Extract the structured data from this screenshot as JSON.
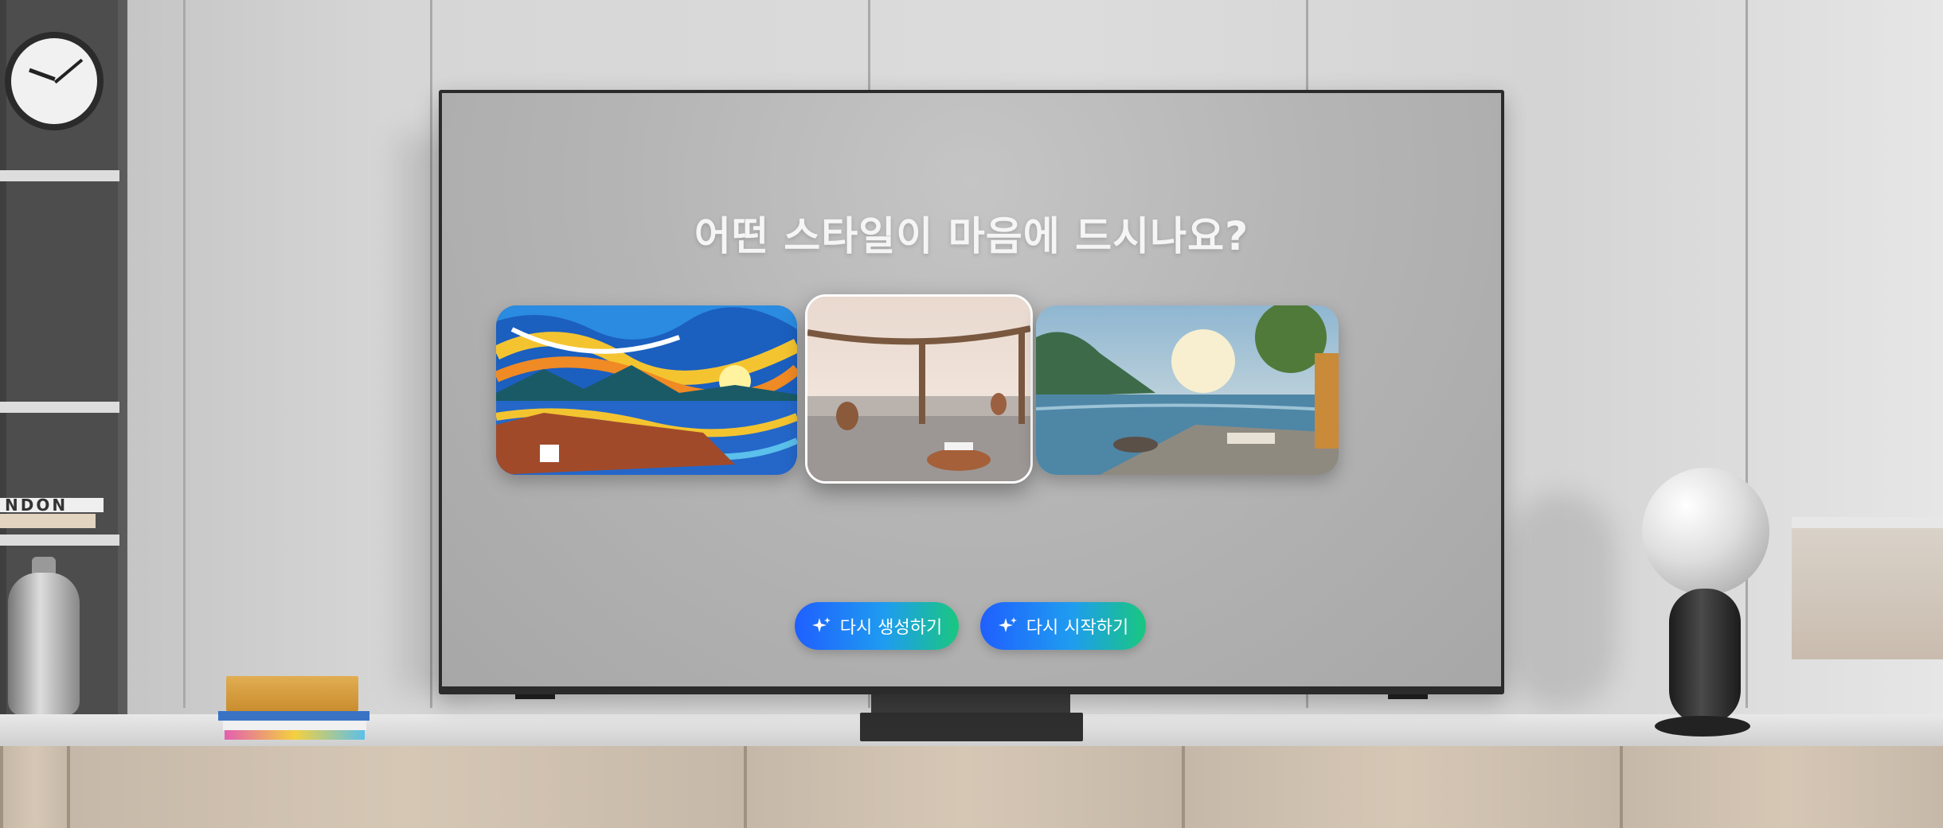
{
  "prompt": {
    "question": "어떤 스타일이 마음에 드시나요?"
  },
  "style_options": [
    {
      "icon": "impressionist-swirl-painting",
      "selected": false
    },
    {
      "icon": "minimal-infinity-pool-pergola",
      "selected": true
    },
    {
      "icon": "painted-lakeside-terrace",
      "selected": false
    }
  ],
  "actions": {
    "regenerate_label": "다시 생성하기",
    "restart_label": "다시 시작하기",
    "icon": "sparkle-icon"
  },
  "room": {
    "book_spine_text": "NDON"
  },
  "colors": {
    "button_gradient_start": "#1f5fff",
    "button_gradient_end": "#19c77f",
    "screen_bg": "#b5b5b5",
    "question_text": "#f5f5f5"
  }
}
